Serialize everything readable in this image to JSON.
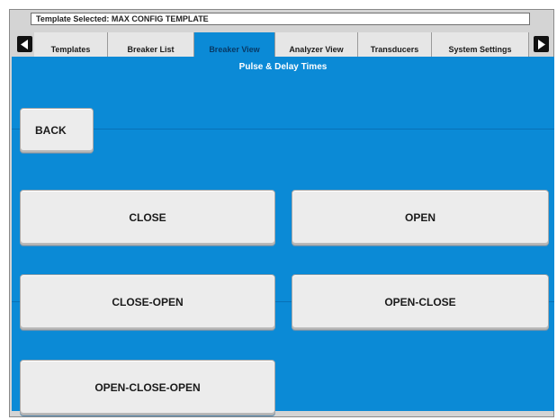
{
  "header": {
    "template_selected": "Template Selected: MAX CONFIG TEMPLATE"
  },
  "tabs": [
    {
      "label": "Templates",
      "active": false
    },
    {
      "label": "Breaker List",
      "active": false
    },
    {
      "label": "Breaker View",
      "active": true
    },
    {
      "label": "Analyzer View",
      "active": false
    },
    {
      "label": "Transducers",
      "active": false
    },
    {
      "label": "System Settings",
      "active": false
    }
  ],
  "nav": {
    "prev_icon": "arrow-left-icon",
    "next_icon": "arrow-right-icon"
  },
  "page": {
    "title": "Pulse & Delay Times"
  },
  "buttons": {
    "back": "BACK",
    "close": "CLOSE",
    "open": "OPEN",
    "close_open": "CLOSE-OPEN",
    "open_close": "OPEN-CLOSE",
    "open_close_open": "OPEN-CLOSE-OPEN"
  },
  "colors": {
    "accent": "#0b8ad6",
    "panel": "#d4d4d4",
    "button": "#ececec"
  }
}
